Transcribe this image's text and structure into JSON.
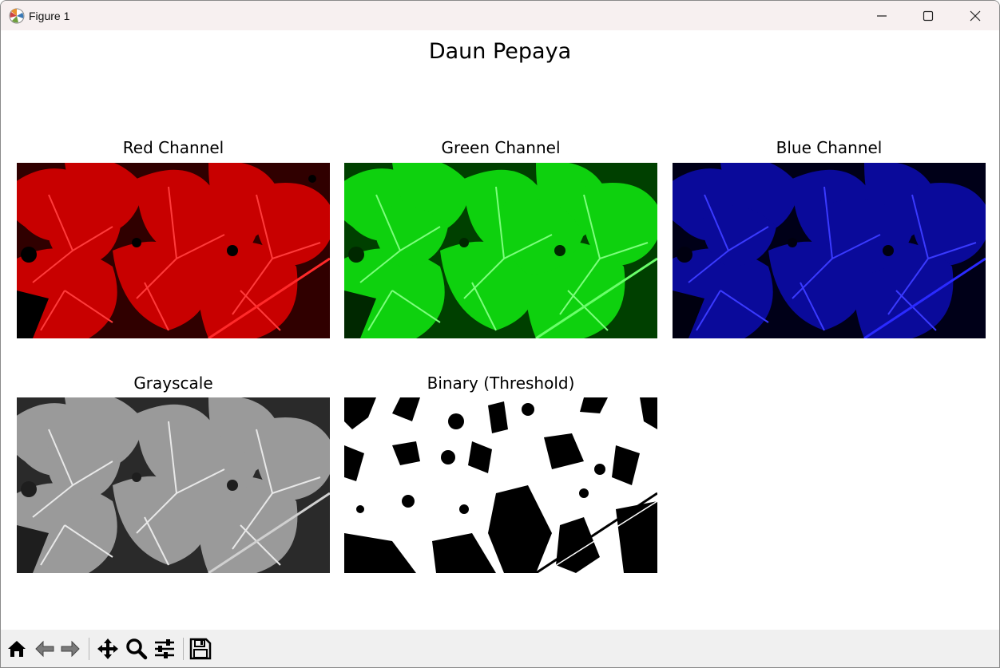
{
  "window": {
    "title": "Figure 1"
  },
  "figure": {
    "suptitle": "Daun Pepaya",
    "axes": [
      {
        "title": "Red Channel",
        "tint": "#ff0000"
      },
      {
        "title": "Green Channel",
        "tint": "#00ff00"
      },
      {
        "title": "Blue Channel",
        "tint": "#1a1aff"
      },
      {
        "title": "Grayscale",
        "tint": "#ffffff"
      },
      {
        "title": "Binary (Threshold)",
        "tint": "#000000"
      }
    ]
  },
  "toolbar": {
    "icons": [
      "home-icon",
      "back-arrow-icon",
      "forward-arrow-icon",
      "pan-move-icon",
      "zoom-magnifier-icon",
      "configure-subplots-icon",
      "save-floppy-icon"
    ]
  }
}
